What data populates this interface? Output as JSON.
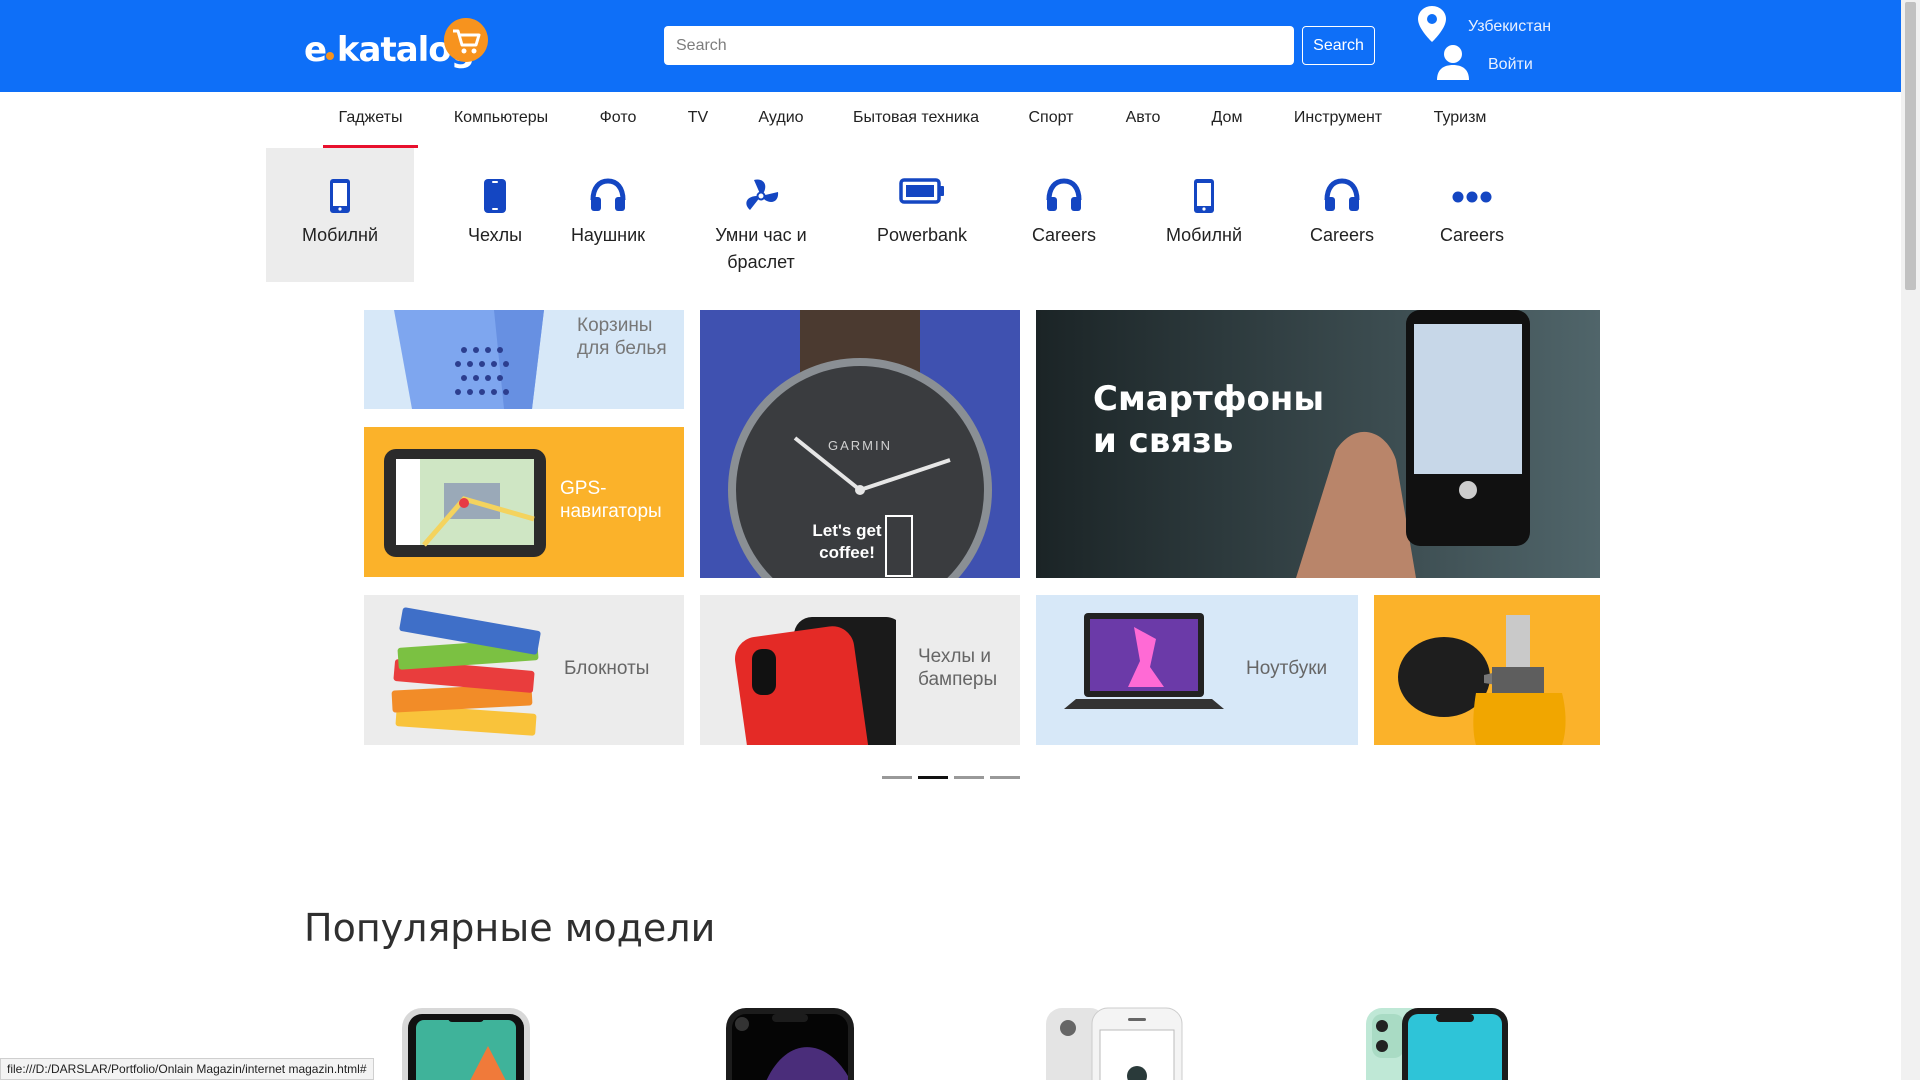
{
  "header": {
    "logo_text": "e katalog",
    "search_placeholder": "Search",
    "search_button": "Search",
    "location": "Узбекистан",
    "login": "Войти"
  },
  "nav": {
    "items": [
      "Гаджеты",
      "Компьютеры",
      "Фото",
      "TV",
      "Аудио",
      "Бытовая техника",
      "Спорт",
      "Авто",
      "Дом",
      "Инструмент",
      "Туризм"
    ],
    "active": "Гаджеты"
  },
  "subcategories": [
    {
      "label": "Мобилнй",
      "icon": "phone-icon"
    },
    {
      "label": "Чехлы",
      "icon": "phone-case-icon"
    },
    {
      "label": "Наушник",
      "icon": "headphones-icon"
    },
    {
      "label": "Умни час и браслет",
      "icon": "fan-icon"
    },
    {
      "label": "Powerbank",
      "icon": "battery-icon"
    },
    {
      "label": "Careers",
      "icon": "headphones-icon"
    },
    {
      "label": "Мобилнй",
      "icon": "phone-icon"
    },
    {
      "label": "Careers",
      "icon": "headphones-icon"
    },
    {
      "label": "Careers",
      "icon": "more-dots-icon"
    }
  ],
  "banners": {
    "baskets": "Корзины для белья",
    "gps": "GPS-навигаторы",
    "watch_brand": "GARMIN",
    "watch_text": "Let's get coffee!",
    "smartphones": "Смартфоны и связь",
    "notebooks": "Блокноты",
    "cases": "Чехлы и бамперы",
    "laptops": "Ноутбуки"
  },
  "carousel": {
    "count": 4,
    "active_index": 1
  },
  "popular": {
    "title": "Популярные модели"
  },
  "status_bar": "file:///D:/DARSLAR/Portfolio/Onlain Magazin/internet magazin.html#",
  "colors": {
    "brand_blue": "#0e6ff8",
    "accent_red": "#e8102d",
    "accent_orange": "#fbb22a",
    "icon_blue": "#1446c2"
  }
}
